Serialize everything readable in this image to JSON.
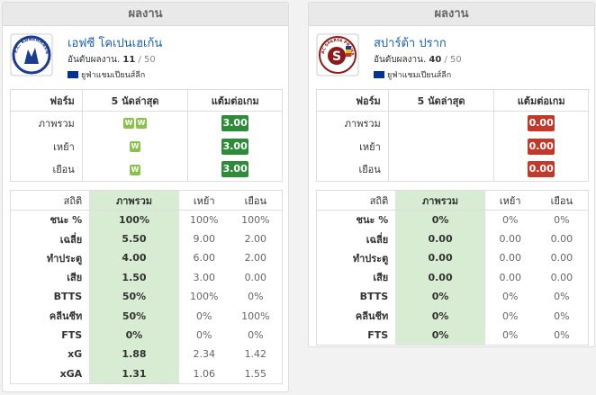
{
  "left": {
    "header": "ผลงาน",
    "team_name": "เอฟซี โคเปนเฮเก้น",
    "rank_label": "อันดับผลงาน.",
    "rank_value": "11",
    "rank_total": "50",
    "league": "ยูฟ่าแชมเปียนส์ลีก",
    "logo_text": "F.C. KØBENHAVN",
    "form_headers": [
      "ฟอร์ม",
      "5 นัดล่าสุด",
      "แต้มต่อเกม"
    ],
    "form_rows": [
      {
        "label": "ภาพรวม",
        "results": [
          "W",
          "W"
        ],
        "points": "3.00"
      },
      {
        "label": "เหย้า",
        "results": [
          "W"
        ],
        "points": "3.00"
      },
      {
        "label": "เยือน",
        "results": [
          "W"
        ],
        "points": "3.00"
      }
    ],
    "stats_headers": [
      "สถิติ",
      "ภาพรวม",
      "เหย้า",
      "เยือน"
    ],
    "stats_rows": [
      {
        "label": "ชนะ %",
        "overall": "100%",
        "home": "100%",
        "away": "100%"
      },
      {
        "label": "เฉลี่ย",
        "overall": "5.50",
        "home": "9.00",
        "away": "2.00"
      },
      {
        "label": "ทำประตู",
        "overall": "4.00",
        "home": "6.00",
        "away": "2.00"
      },
      {
        "label": "เสีย",
        "overall": "1.50",
        "home": "3.00",
        "away": "0.00"
      },
      {
        "label": "BTTS",
        "overall": "50%",
        "home": "100%",
        "away": "0%"
      },
      {
        "label": "คลีนชีท",
        "overall": "50%",
        "home": "0%",
        "away": "100%"
      },
      {
        "label": "FTS",
        "overall": "0%",
        "home": "0%",
        "away": "0%"
      },
      {
        "label": "xG",
        "overall": "1.88",
        "home": "2.34",
        "away": "1.42"
      },
      {
        "label": "xGA",
        "overall": "1.31",
        "home": "1.06",
        "away": "1.55"
      }
    ]
  },
  "right": {
    "header": "ผลงาน",
    "team_name": "สปาร์ต้า ปราก",
    "rank_label": "อันดับผลงาน.",
    "rank_value": "40",
    "rank_total": "50",
    "league": "ยูฟ่าแชมเปียนส์ลีก",
    "logo_text": "AC SPARTA PRAHA",
    "logo_letter": "S",
    "form_headers": [
      "ฟอร์ม",
      "5 นัดล่าสุด",
      "แต้มต่อเกม"
    ],
    "form_rows": [
      {
        "label": "ภาพรวม",
        "results": [],
        "points": "0.00"
      },
      {
        "label": "เหย้า",
        "results": [],
        "points": "0.00"
      },
      {
        "label": "เยือน",
        "results": [],
        "points": "0.00"
      }
    ],
    "stats_headers": [
      "สถิติ",
      "ภาพรวม",
      "เหย้า",
      "เยือน"
    ],
    "stats_rows": [
      {
        "label": "ชนะ %",
        "overall": "0%",
        "home": "0%",
        "away": "0%"
      },
      {
        "label": "เฉลี่ย",
        "overall": "0.00",
        "home": "0.00",
        "away": "0.00"
      },
      {
        "label": "ทำประตู",
        "overall": "0.00",
        "home": "0.00",
        "away": "0.00"
      },
      {
        "label": "เสีย",
        "overall": "0.00",
        "home": "0.00",
        "away": "0.00"
      },
      {
        "label": "BTTS",
        "overall": "0%",
        "home": "0%",
        "away": "0%"
      },
      {
        "label": "คลีนชีท",
        "overall": "0%",
        "home": "0%",
        "away": "0%"
      },
      {
        "label": "FTS",
        "overall": "0%",
        "home": "0%",
        "away": "0%"
      }
    ]
  },
  "colors": {
    "win_badge": "#8bc34a",
    "points_good": "#2e8b3a",
    "points_bad": "#c0392b",
    "overall_column": "#d7ecd2",
    "team_link": "#1a5fb4"
  }
}
